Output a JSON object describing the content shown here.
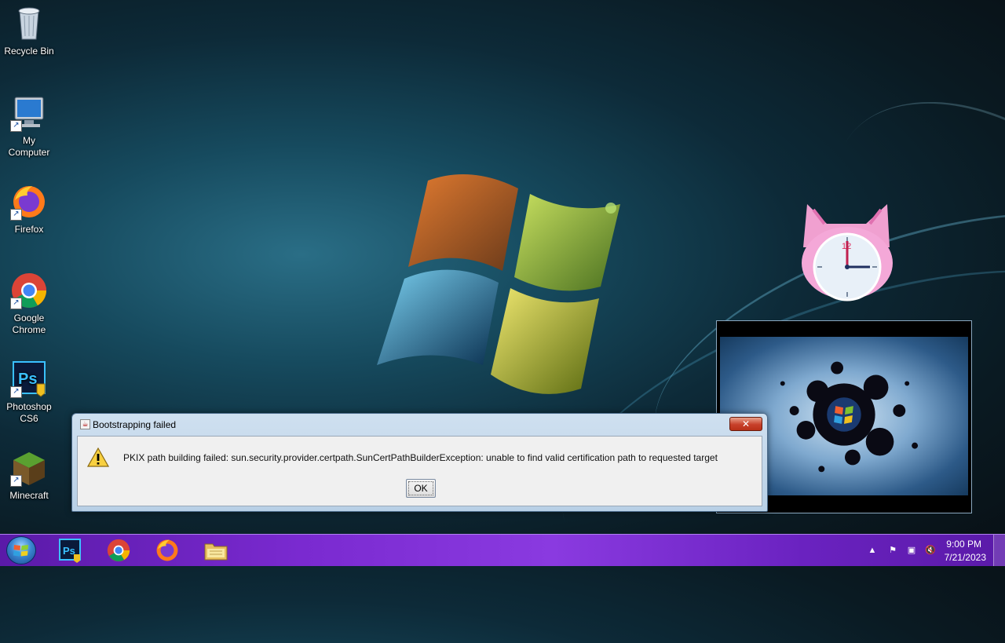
{
  "desktop_icons": [
    {
      "label": "Recycle Bin",
      "icon": "recycle-bin-icon"
    },
    {
      "label": "My\nComputer",
      "icon": "computer-icon"
    },
    {
      "label": "Firefox",
      "icon": "firefox-icon"
    },
    {
      "label": "Google\nChrome",
      "icon": "chrome-icon"
    },
    {
      "label": "Photoshop\nCS6",
      "icon": "photoshop-icon"
    },
    {
      "label": "Minecraft",
      "icon": "minecraft-icon"
    }
  ],
  "dialog": {
    "title": "Bootstrapping failed",
    "close_label": "✕",
    "message": "PKIX path building failed: sun.security.provider.certpath.SunCertPathBuilderException: unable to find valid certification path to requested target",
    "ok_label": "OK"
  },
  "clock_gadget": {
    "numeral": "12"
  },
  "photoshop_glyph": "Ps",
  "taskbar": {
    "apps": [
      "photoshop-icon",
      "chrome-icon",
      "firefox-icon",
      "file-explorer-icon"
    ],
    "time": "9:00 PM",
    "date": "7/21/2023"
  },
  "colors": {
    "taskbar": "#7a2ad0",
    "dialog_close": "#c8402a"
  }
}
